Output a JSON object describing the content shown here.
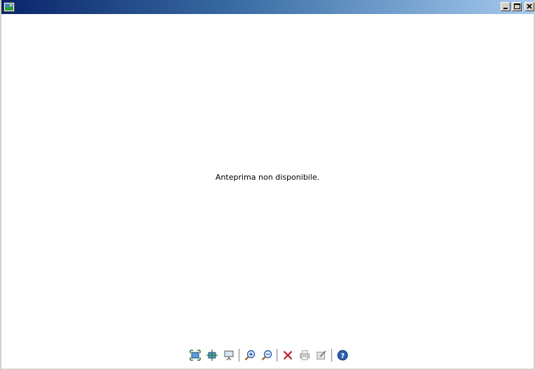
{
  "window": {
    "controls": [
      "minimize",
      "maximize",
      "close"
    ]
  },
  "preview": {
    "message": "Anteprima non disponibile."
  },
  "toolbar": {
    "items": [
      {
        "icon": "fit-to-window-icon",
        "enabled": true
      },
      {
        "icon": "actual-size-icon",
        "enabled": true
      },
      {
        "icon": "slideshow-icon",
        "enabled": true
      },
      {
        "icon": "zoom-in-icon",
        "enabled": true
      },
      {
        "icon": "zoom-out-icon",
        "enabled": true
      },
      {
        "icon": "delete-icon",
        "enabled": true
      },
      {
        "icon": "print-icon",
        "enabled": false
      },
      {
        "icon": "edit-icon",
        "enabled": false
      },
      {
        "icon": "help-icon",
        "enabled": true
      }
    ]
  },
  "colors": {
    "title_start": "#0a246a",
    "title_end": "#a6caf0",
    "delete_red": "#c0202a",
    "help_blue": "#2a5fb0"
  }
}
